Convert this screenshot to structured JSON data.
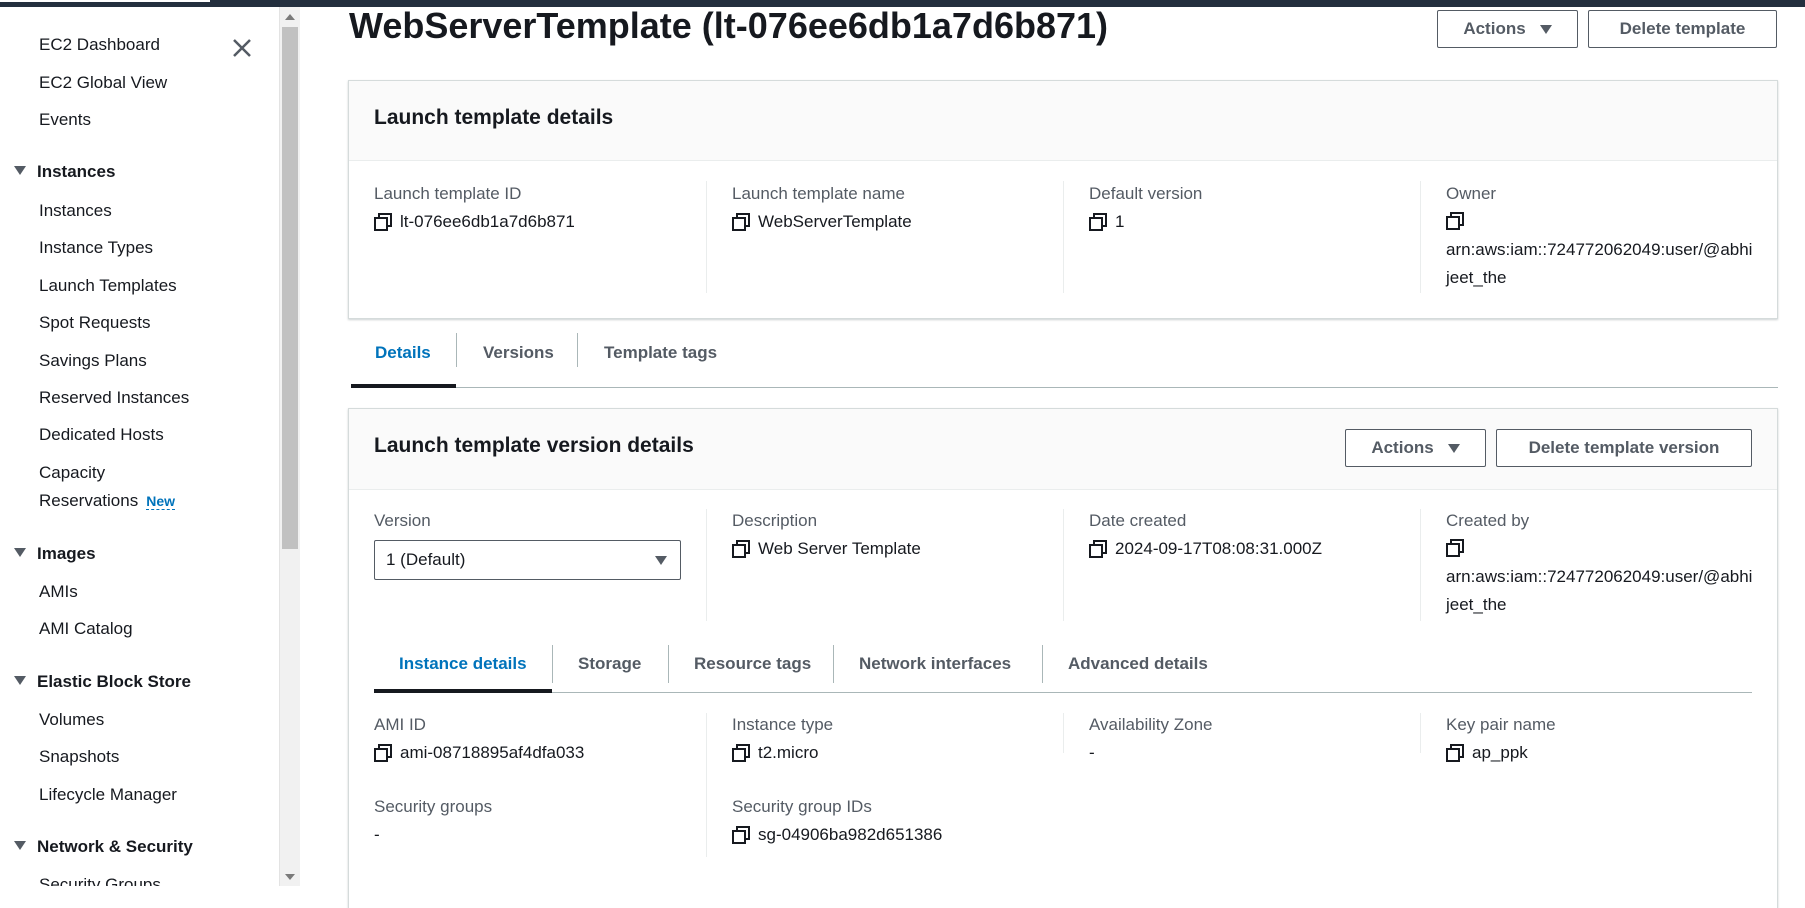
{
  "sidebar": {
    "top_items": [
      {
        "label": "EC2 Dashboard"
      },
      {
        "label": "EC2 Global View"
      },
      {
        "label": "Events"
      }
    ],
    "sections": [
      {
        "title": "Instances",
        "items": [
          "Instances",
          "Instance Types",
          "Launch Templates",
          "Spot Requests",
          "Savings Plans",
          "Reserved Instances",
          "Dedicated Hosts"
        ]
      },
      {
        "title": "Images",
        "items": [
          "AMIs",
          "AMI Catalog"
        ]
      },
      {
        "title": "Elastic Block Store",
        "items": [
          "Volumes",
          "Snapshots",
          "Lifecycle Manager"
        ]
      },
      {
        "title": "Network & Security",
        "items": [
          "Security Groups"
        ]
      }
    ],
    "capacity_line1": "Capacity",
    "capacity_line2": "Reservations",
    "new_badge": "New"
  },
  "page": {
    "title": "WebServerTemplate (lt-076ee6db1a7d6b871)",
    "actions_label": "Actions",
    "delete_label": "Delete template"
  },
  "details_panel": {
    "title": "Launch template details",
    "fields": [
      {
        "label": "Launch template ID",
        "value": "lt-076ee6db1a7d6b871"
      },
      {
        "label": "Launch template name",
        "value": "WebServerTemplate"
      },
      {
        "label": "Default version",
        "value": "1"
      },
      {
        "label": "Owner",
        "value": "arn:aws:iam::724772062049:user/@abhijeet_the"
      }
    ]
  },
  "main_tabs": [
    "Details",
    "Versions",
    "Template tags"
  ],
  "version_panel": {
    "title": "Launch template version details",
    "actions_label": "Actions",
    "delete_label": "Delete template version",
    "version_label": "Version",
    "version_value": "1 (Default)",
    "fields": [
      {
        "label": "Description",
        "value": "Web Server Template"
      },
      {
        "label": "Date created",
        "value": "2024-09-17T08:08:31.000Z"
      },
      {
        "label": "Created by",
        "value": "arn:aws:iam::724772062049:user/@abhijeet_the"
      }
    ],
    "sub_tabs": [
      "Instance details",
      "Storage",
      "Resource tags",
      "Network interfaces",
      "Advanced details"
    ],
    "instance_fields": [
      {
        "label": "AMI ID",
        "value": "ami-08718895af4dfa033"
      },
      {
        "label": "Instance type",
        "value": "t2.micro"
      },
      {
        "label": "Availability Zone",
        "value": "-"
      },
      {
        "label": "Key pair name",
        "value": "ap_ppk"
      },
      {
        "label": "Security groups",
        "value": "-"
      },
      {
        "label": "Security group IDs",
        "value": "sg-04906ba982d651386"
      }
    ]
  }
}
